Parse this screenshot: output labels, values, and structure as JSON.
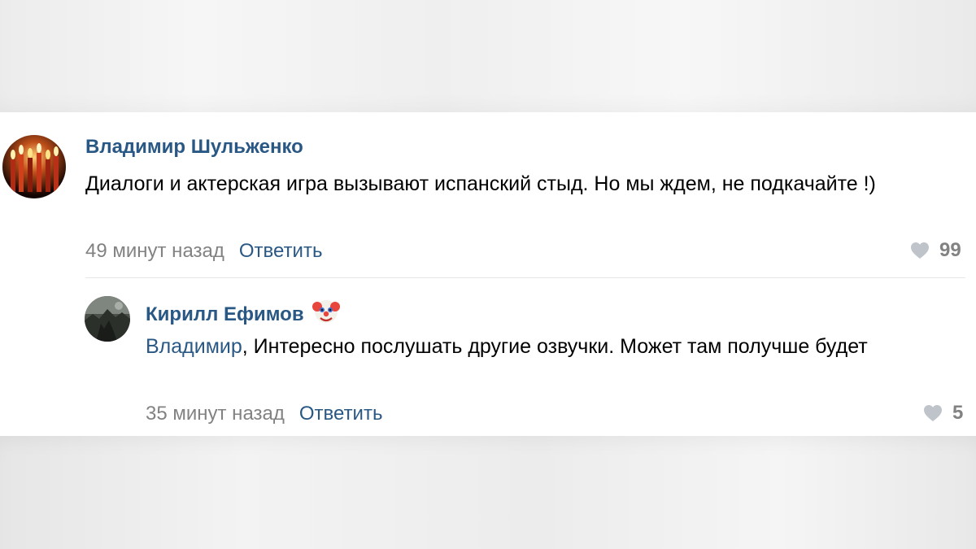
{
  "comments": [
    {
      "author": "Владимир Шульженко",
      "text": "Диалоги и актерская игра вызывают испанский стыд. Но мы ждем, не подкачайте !)",
      "time": "49 минут назад",
      "reply_label": "Ответить",
      "likes": "99"
    }
  ],
  "replies": [
    {
      "author": "Кирилл Ефимов",
      "author_icon": "clown-face-emoji",
      "reply_to": "Владимир",
      "text": ", Интересно послушать другие озвучки. Может там получше будет",
      "time": "35 минут назад",
      "reply_label": "Ответить",
      "likes": "5"
    }
  ],
  "colors": {
    "link": "#2a5885",
    "meta": "#828282",
    "heart": "#bfc4ca"
  }
}
